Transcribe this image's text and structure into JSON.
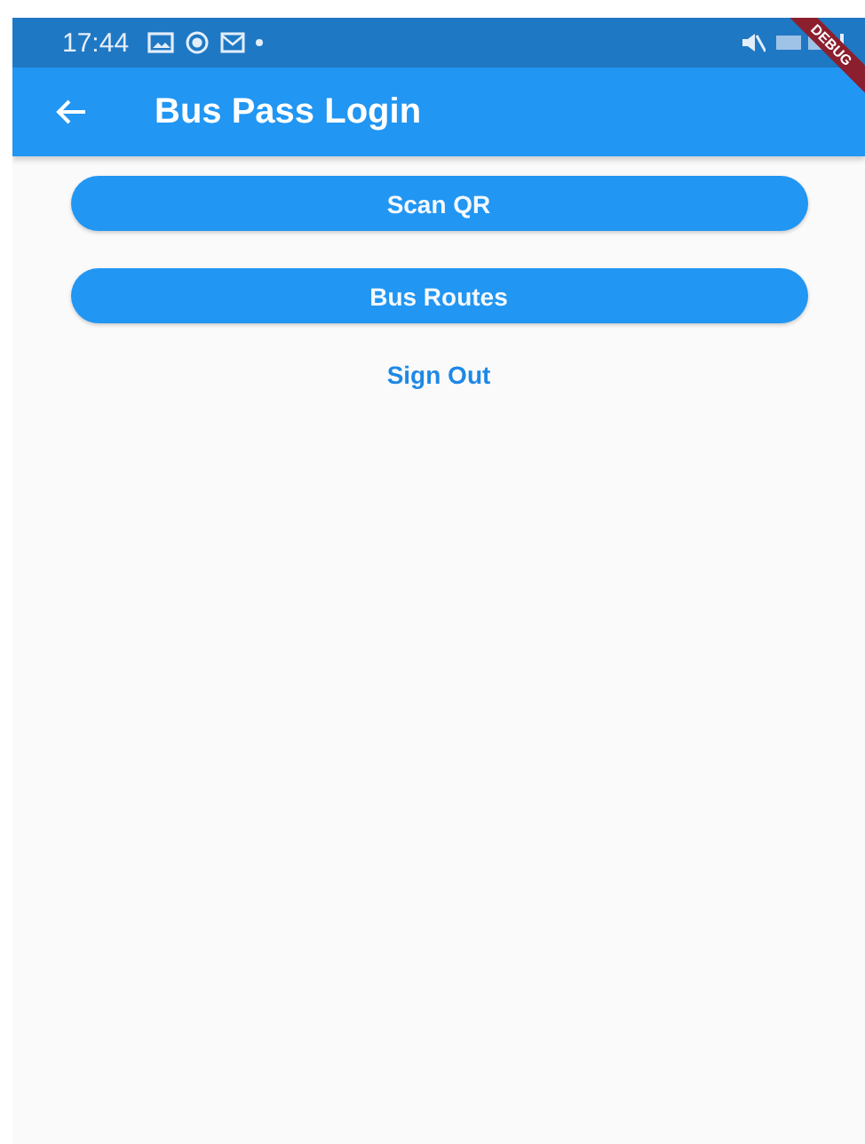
{
  "status_bar": {
    "time": "17:44"
  },
  "debug_banner": "DEBUG",
  "app_bar": {
    "title": "Bus Pass Login"
  },
  "buttons": [
    {
      "label": "Scan QR",
      "kind": "filled"
    },
    {
      "label": "Bus Routes",
      "kind": "filled"
    },
    {
      "label": "Sign Out",
      "kind": "text"
    }
  ]
}
